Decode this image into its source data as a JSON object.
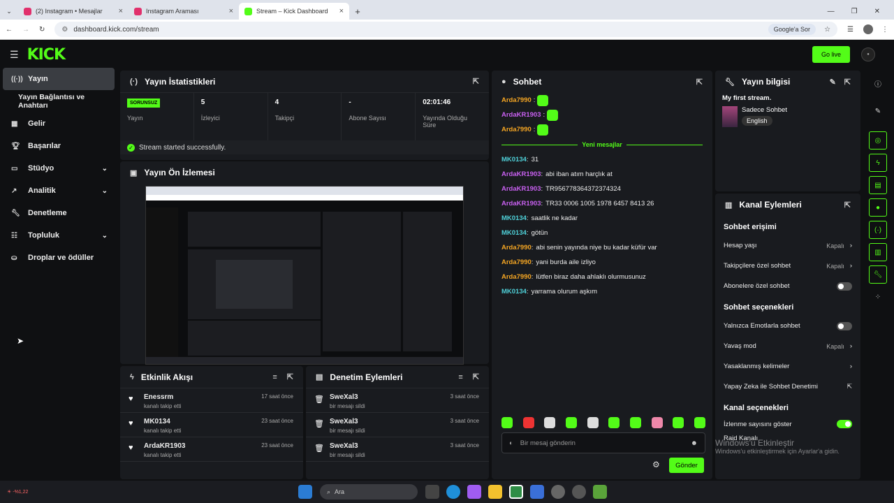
{
  "browser": {
    "tabs": [
      {
        "label": "(2) Instagram • Mesajlar",
        "color": "#e1306c"
      },
      {
        "label": "Instagram Araması",
        "color": "#e1306c"
      },
      {
        "label": "Stream – Kick Dashboard",
        "color": "#53fc18"
      }
    ],
    "url": "dashboard.kick.com/stream",
    "google_sor": "Google'a Sor"
  },
  "topbar": {
    "logo": "KICK",
    "go_live": "Go live"
  },
  "sidebar": {
    "items": [
      {
        "label": "Yayın",
        "icon": "stream-icon"
      },
      {
        "label": "Yayın Bağlantısı ve Anahtarı",
        "icon": ""
      },
      {
        "label": "Gelir",
        "icon": "revenue-icon"
      },
      {
        "label": "Başarılar",
        "icon": "trophy-icon"
      },
      {
        "label": "Stüdyo",
        "icon": "studio-icon"
      },
      {
        "label": "Analitik",
        "icon": "analytics-icon"
      },
      {
        "label": "Denetleme",
        "icon": "wrench-icon"
      },
      {
        "label": "Topluluk",
        "icon": "community-icon"
      },
      {
        "label": "Droplar ve ödüller",
        "icon": "drops-icon"
      }
    ]
  },
  "stats": {
    "title": "Yayın İstatistikleri",
    "status": "SORUNSUZ",
    "items": [
      {
        "value": "",
        "label": "Yayın"
      },
      {
        "value": "5",
        "label": "İzleyici"
      },
      {
        "value": "4",
        "label": "Takipçi"
      },
      {
        "value": "-",
        "label": "Abone Sayısı"
      },
      {
        "value": "02:01:46",
        "label": "Yayında Olduğu Süre"
      }
    ],
    "success": "Stream started successfully."
  },
  "preview": {
    "title": "Yayın Ön İzlemesi"
  },
  "activity": {
    "title": "Etkinlik Akışı",
    "rows": [
      {
        "name": "Enessrm",
        "sub": "kanalı takip etti",
        "time": "17 saat önce"
      },
      {
        "name": "MK0134",
        "sub": "kanalı takip etti",
        "time": "23 saat önce"
      },
      {
        "name": "ArdaKR1903",
        "sub": "kanalı takip etti",
        "time": "23 saat önce"
      }
    ]
  },
  "moderation": {
    "title": "Denetim Eylemleri",
    "rows": [
      {
        "name": "SweXal3",
        "sub": "bir mesajı sildi",
        "time": "3 saat önce"
      },
      {
        "name": "SweXal3",
        "sub": "bir mesajı sildi",
        "time": "3 saat önce"
      },
      {
        "name": "SweXal3",
        "sub": "bir mesajı sildi",
        "time": "3 saat önce"
      }
    ]
  },
  "chat": {
    "title": "Sohbet",
    "emote_messages": [
      {
        "user": "Arda7990",
        "color": "#f5a623"
      },
      {
        "user": "ArdaKR1903",
        "color": "#c860f0"
      },
      {
        "user": "Arda7990",
        "color": "#f5a623"
      }
    ],
    "new_messages": "Yeni mesajlar",
    "messages": [
      {
        "user": "MK0134",
        "color": "#4fd1d9",
        "text": "31"
      },
      {
        "user": "ArdaKR1903",
        "color": "#c860f0",
        "text": "abi iban atım harçlık at"
      },
      {
        "user": "ArdaKR1903",
        "color": "#c860f0",
        "text": "TR956778364372374324"
      },
      {
        "user": "ArdaKR1903",
        "color": "#c860f0",
        "text": "TR33 0006 1005 1978 6457 8413 26"
      },
      {
        "user": "MK0134",
        "color": "#4fd1d9",
        "text": "saatlik ne kadar"
      },
      {
        "user": "MK0134",
        "color": "#4fd1d9",
        "text": "götün"
      },
      {
        "user": "Arda7990",
        "color": "#f5a623",
        "text": "abi senin yayında niye bu kadar küfür var"
      },
      {
        "user": "Arda7990",
        "color": "#f5a623",
        "text": "yani burda aile izliyo"
      },
      {
        "user": "Arda7990",
        "color": "#f5a623",
        "text": "lütfen biraz daha ahlaklı olurmusunuz"
      },
      {
        "user": "MK0134",
        "color": "#4fd1d9",
        "text": "yarrama olurum aşkım"
      }
    ],
    "placeholder": "Bir mesaj gönderin",
    "send": "Gönder"
  },
  "info": {
    "title": "Yayın bilgisi",
    "stream_title": "My first stream.",
    "category": "Sadece Sohbet",
    "language": "English"
  },
  "channel": {
    "title": "Kanal Eylemleri",
    "access_title": "Sohbet erişimi",
    "account_age": "Hesap yaşı",
    "account_age_value": "Kapalı",
    "followers_only": "Takipçilere özel sohbet",
    "followers_only_value": "Kapalı",
    "subs_only": "Abonelere özel sohbet",
    "options_title": "Sohbet seçenekleri",
    "emotes_only": "Yalnızca Emotlarla sohbet",
    "slow_mode": "Yavaş mod",
    "slow_mode_value": "Kapalı",
    "banned_words": "Yasaklanmış kelimeler",
    "ai_moderation": "Yapay Zeka ile Sohbet Denetimi",
    "channel_options_title": "Kanal seçenekleri",
    "viewer_count": "İzlenme sayısını göster",
    "raid": "Raid Kanalı"
  },
  "watermark": {
    "line1": "Windows'u Etkinleştir",
    "line2": "Windows'u etkinleştirmek için Ayarlar'a gidin."
  },
  "taskbar": {
    "search": "Ara",
    "temp": "-%1,22"
  }
}
